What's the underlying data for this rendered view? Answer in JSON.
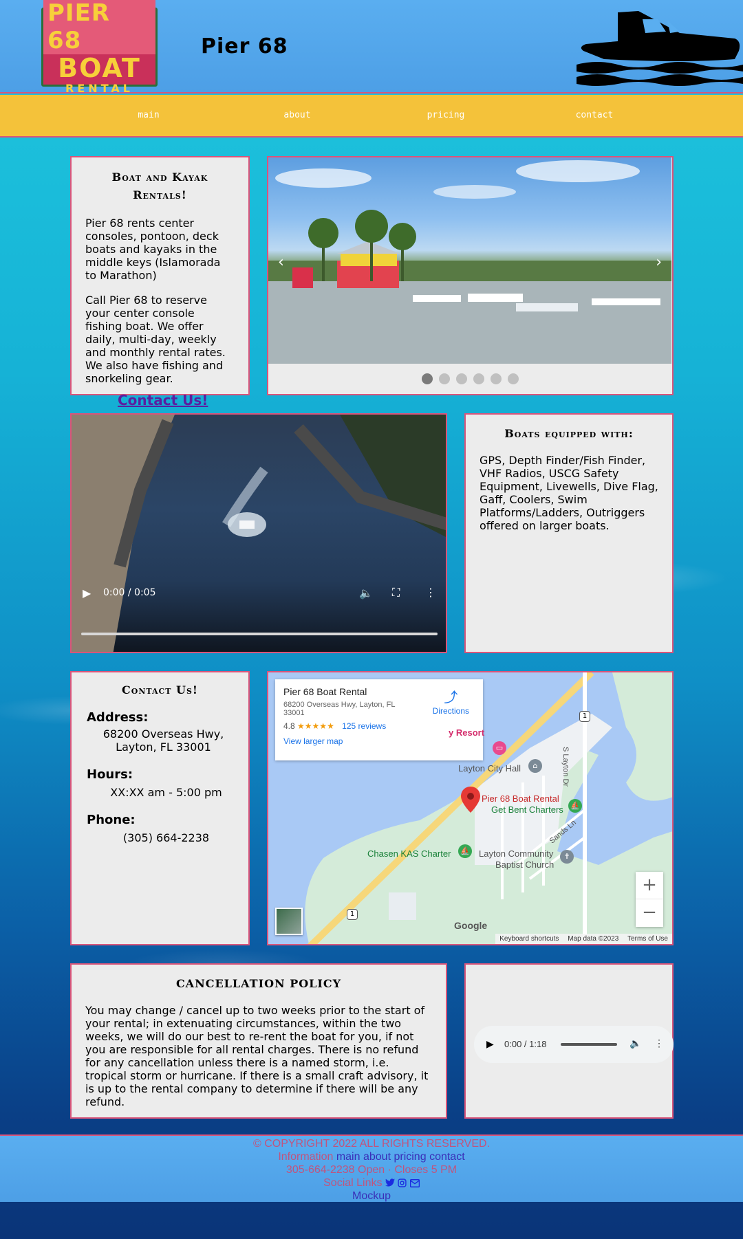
{
  "header": {
    "logo_line1": "PIER 68",
    "logo_line2": "BOAT",
    "logo_line3": "RENTAL",
    "site_title": "Pier 68"
  },
  "nav": {
    "items": [
      "main",
      "about",
      "pricing",
      "contact"
    ]
  },
  "rentals": {
    "heading": "Boat and Kayak Rentals!",
    "p1": "Pier 68 rents center consoles, pontoon, deck boats and kayaks in the middle keys (Islamorada to Marathon)",
    "p2": "Call Pier 68 to reserve your center console fishing boat. We offer daily, multi-day, weekly and monthly rental rates. We also have fishing and snorkeling gear."
  },
  "carousel": {
    "prev": "‹",
    "next": "›",
    "slide_count": 6,
    "active_slide": 1
  },
  "contact_link": "Contact Us!",
  "video": {
    "time": "0:00 / 0:05"
  },
  "equipped": {
    "heading": "Boats equipped with:",
    "text": "GPS, Depth Finder/Fish Finder, VHF Radios, USCG Safety Equipment, Livewells, Dive Flag, Gaff, Coolers, Swim Platforms/Ladders, Outriggers offered on larger boats."
  },
  "contact": {
    "heading": "Contact Us!",
    "address_label": "Address:",
    "address_line1": "68200 Overseas Hwy,",
    "address_line2": "Layton, FL 33001",
    "hours_label": "Hours:",
    "hours": "XX:XX am - 5:00 pm",
    "phone_label": "Phone:",
    "phone": "(305) 664-2238"
  },
  "map": {
    "place_name": "Pier 68 Boat Rental",
    "place_address": "68200 Overseas Hwy, Layton, FL 33001",
    "rating": "4.8",
    "stars": "★★★★★",
    "reviews": "125 reviews",
    "view_larger": "View larger map",
    "directions": "Directions",
    "labels": {
      "resort": "y Resort",
      "city_hall": "Layton City Hall",
      "pin_label": "Pier 68 Boat Rental",
      "get_bent": "Get Bent Charters",
      "chasen": "Chasen KAS Charter",
      "church1": "Layton Community",
      "church2": "Baptist Church",
      "road_layton": "S Layton Dr",
      "road_sands": "Sands Ln",
      "highway": "1"
    },
    "zoom_in": "+",
    "zoom_out": "−",
    "google": "Google",
    "attr_shortcuts": "Keyboard shortcuts",
    "attr_data": "Map data ©2023",
    "attr_terms": "Terms of Use"
  },
  "cancellation": {
    "heading": "CANCELLATION POLICY",
    "text": "You may change / cancel up to two weeks prior to the start of your rental; in extenuating circumstances, within the two weeks, we will do our best to re-rent the boat for you, if not you are responsible for all rental charges. There is no refund for any cancellation unless there is a named storm, i.e. tropical storm or hurricane. If there is a small craft advisory, it is up to the rental company to determine if there will be any refund."
  },
  "audio": {
    "time": "0:00 / 1:18"
  },
  "footer": {
    "copyright": "© COPYRIGHT 2022 ALL RIGHTS RESERVED.",
    "info_label": "Information",
    "links": [
      "main",
      "about",
      "pricing",
      "contact"
    ],
    "hours_line": "305-664-2238 Open · Closes 5 PM",
    "social_label": "Social Links",
    "mockup": "Mockup"
  },
  "colors": {
    "header_blue": "#4d9fe6",
    "nav_yellow": "#f4c23a",
    "panel_border": "#d9557a",
    "panel_bg": "#ececec",
    "link_purple": "#5a1fa0"
  }
}
